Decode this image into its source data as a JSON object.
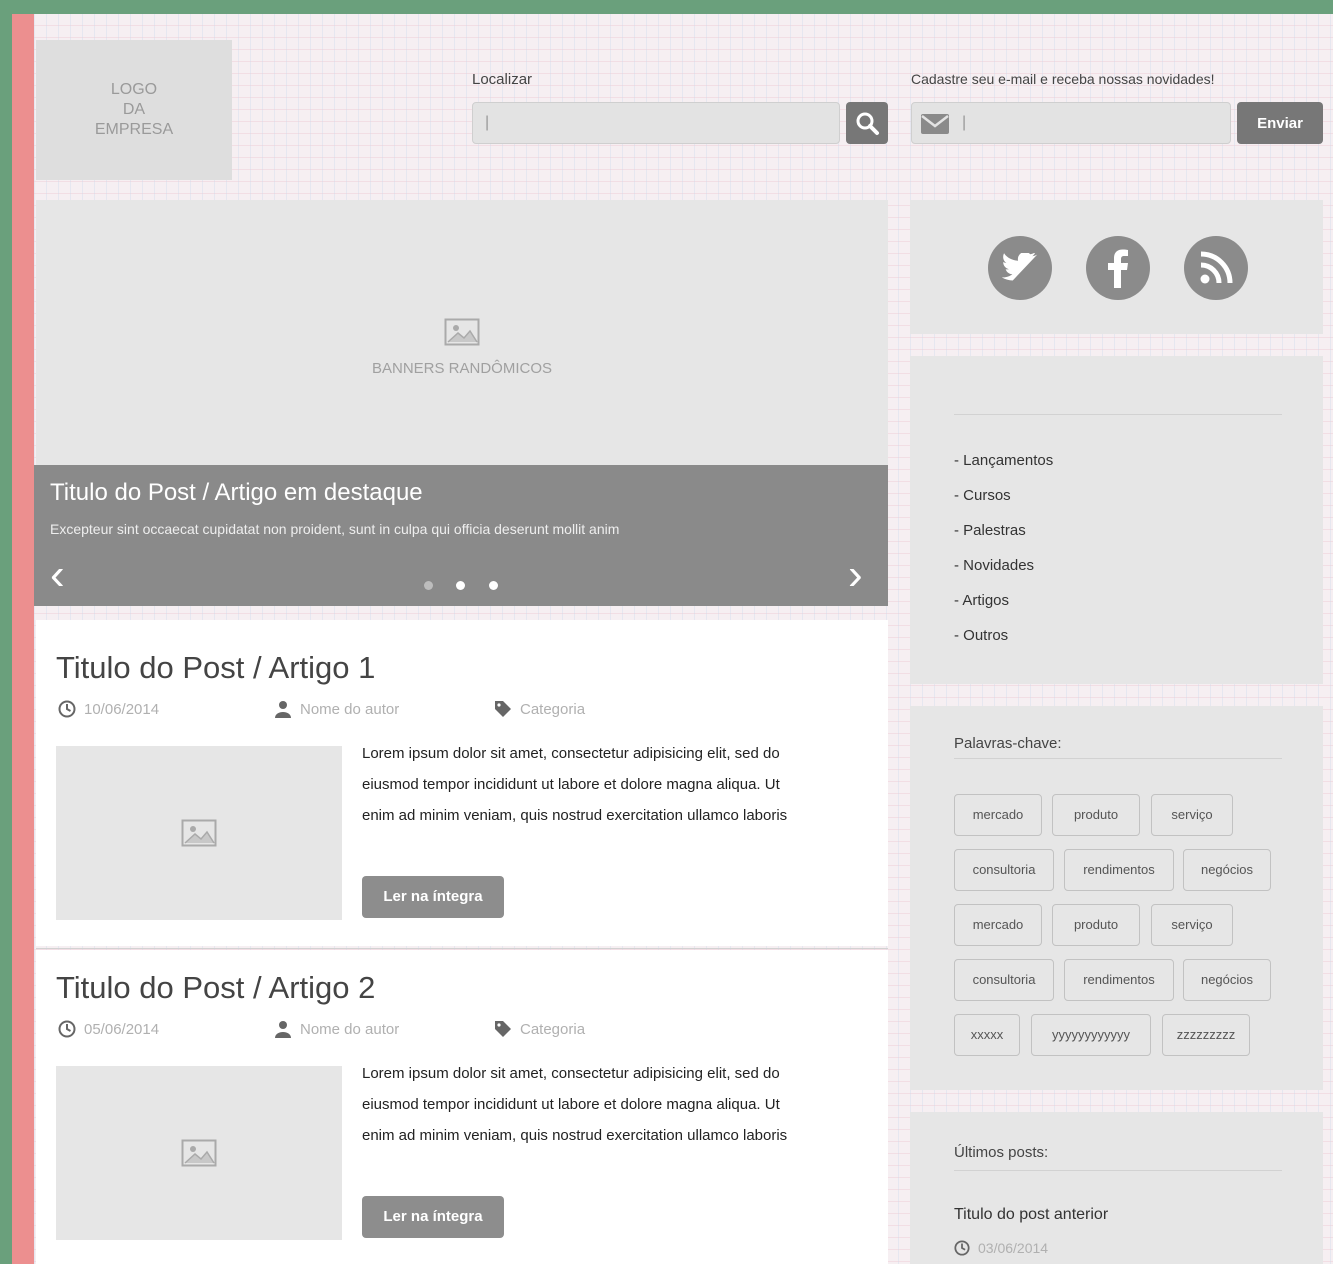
{
  "header": {
    "logo": [
      "LOGO",
      "DA",
      "EMPRESA"
    ],
    "search": {
      "label": "Localizar",
      "value": "|"
    },
    "newsletter": {
      "label": "Cadastre seu e-mail e receba nossas novidades!",
      "value": "|",
      "button": "Enviar"
    }
  },
  "banner": {
    "placeholder": "BANNERS RANDÔMICOS",
    "title": "Titulo do Post / Artigo em destaque",
    "text": "Excepteur sint occaecat cupidatat non proident, sunt in culpa qui officia deserunt mollit anim",
    "prev": "‹",
    "next": "›"
  },
  "posts": [
    {
      "title": "Titulo do Post / Artigo 1",
      "date": "10/06/2014",
      "author": "Nome do autor",
      "category": "Categoria",
      "lines": [
        "Lorem ipsum dolor sit amet, consectetur adipisicing elit, sed do",
        "eiusmod tempor incididunt ut labore et dolore magna aliqua. Ut",
        "enim ad minim veniam, quis nostrud exercitation ullamco laboris"
      ],
      "button": "Ler na íntegra"
    },
    {
      "title": "Titulo do Post / Artigo 2",
      "date": "05/06/2014",
      "author": "Nome do autor",
      "category": "Categoria",
      "lines": [
        "Lorem ipsum dolor sit amet, consectetur adipisicing elit, sed do",
        "eiusmod tempor incididunt ut labore et dolore magna aliqua. Ut",
        "enim ad minim veniam, quis nostrud exercitation ullamco laboris"
      ],
      "button": "Ler na íntegra"
    }
  ],
  "social": [
    "twitter-icon",
    "facebook-icon",
    "rss-icon"
  ],
  "categories": [
    "- Lançamentos",
    "- Cursos",
    "- Palestras",
    "- Novidades",
    "- Artigos",
    "- Outros"
  ],
  "keywords": {
    "title": "Palavras-chave:",
    "tags": [
      "mercado",
      "produto",
      "serviço",
      "consultoria",
      "rendimentos",
      "negócios",
      "mercado",
      "produto",
      "serviço",
      "consultoria",
      "rendimentos",
      "negócios",
      "xxxxx",
      "yyyyyyyyyyyy",
      "zzzzzzzzz"
    ]
  },
  "recent": {
    "title": "Últimos posts:",
    "post_title": "Titulo do post anterior",
    "post_date": "03/06/2014"
  },
  "colors": {
    "background": "#6aa07c",
    "panel": "#e6e6e6",
    "accent": "#8a8a8a",
    "stripe": "#ec8f8f"
  }
}
